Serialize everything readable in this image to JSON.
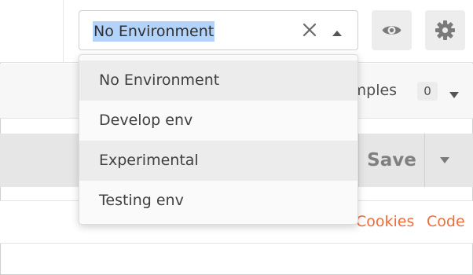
{
  "environment": {
    "selected": "No Environment",
    "options": [
      "No Environment",
      "Develop env",
      "Experimental",
      "Testing env"
    ]
  },
  "examples": {
    "label": "amples",
    "count": "0"
  },
  "request": {
    "save_label": "Save"
  },
  "links": {
    "cookies": "Cookies",
    "code": "Code"
  },
  "colors": {
    "selection_highlight": "#b3d3fb",
    "link": "#f26b3a",
    "button_bg": "#ededed"
  },
  "icons": {
    "clear": "close-icon",
    "collapse": "chevron-up-icon",
    "quick_look": "eye-icon",
    "settings": "gear-icon",
    "examples_toggle": "chevron-down-icon",
    "save_menu": "chevron-down-icon"
  }
}
